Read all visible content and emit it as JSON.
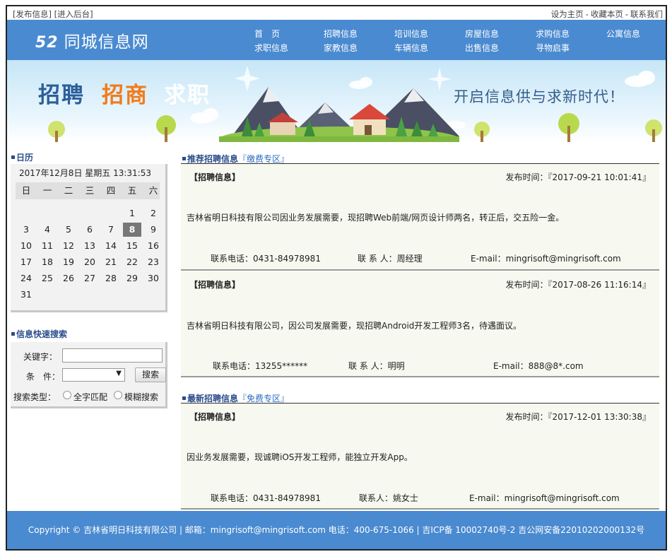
{
  "topbar": {
    "publish": "[发布信息]",
    "admin": "[进入后台]",
    "set_home": "设为主页",
    "bookmark": "收藏本页",
    "contact": "联系我们",
    "sep": "-"
  },
  "logo": {
    "num": "52",
    "text": "同城信息网"
  },
  "nav": {
    "home": "首　页",
    "job_seek": "求职信息",
    "recruit": "招聘信息",
    "tutor": "家教信息",
    "training": "培训信息",
    "vehicle": "车辆信息",
    "housing": "房屋信息",
    "sale": "出售信息",
    "purchase": "求购信息",
    "lost_found": "寻物启事",
    "apartment": "公寓信息"
  },
  "banner": {
    "word1": "招聘",
    "word2": "招商",
    "word3": "求职",
    "slogan": "开启信息供与求新时代！",
    "colors": {
      "word1": "#2c5f9a",
      "word2": "#f07b1c",
      "word3": "#ffffff"
    }
  },
  "calendar": {
    "title": "日历",
    "datetime": "2017年12月8日 星期五 13:31:53",
    "weekdays": [
      "日",
      "一",
      "二",
      "三",
      "四",
      "五",
      "六"
    ],
    "today": "8",
    "weeks": [
      [
        "",
        "",
        "",
        "",
        "",
        "1",
        "2"
      ],
      [
        "3",
        "4",
        "5",
        "6",
        "7",
        "8",
        "9"
      ],
      [
        "10",
        "11",
        "12",
        "13",
        "14",
        "15",
        "16"
      ],
      [
        "17",
        "18",
        "19",
        "20",
        "21",
        "22",
        "23"
      ],
      [
        "24",
        "25",
        "26",
        "27",
        "28",
        "29",
        "30"
      ],
      [
        "31",
        "",
        "",
        "",
        "",
        "",
        ""
      ]
    ]
  },
  "search": {
    "title": "信息快速搜索",
    "keyword_label": "关键字：",
    "keyword_value": "",
    "condition_label": "条　件：",
    "condition_value": "",
    "button": "搜索",
    "type_label": "搜索类型：",
    "exact": "全字匹配",
    "fuzzy": "模糊搜索"
  },
  "recommended": {
    "title": "推荐招聘信息",
    "tag": "『缴费专区』",
    "items": [
      {
        "type": "【招聘信息】",
        "time": "发布时间：『2017-09-21 10:01:41』",
        "desc": "吉林省明日科技有限公司因业务发展需要，现招聘Web前端/网页设计师两名，转正后，交五险一金。",
        "phone": "联系电话：0431-84978981",
        "person": "联 系 人：周经理",
        "email": "E-mail：mingrisoft@mingrisoft.com"
      },
      {
        "type": "【招聘信息】",
        "time": "发布时间：『2017-08-26 11:16:14』",
        "desc": "吉林省明日科技有限公司，因公司发展需要，现招聘Android开发工程师3名，待遇面议。",
        "phone": "联系电话：13255******",
        "person": "联 系 人：明明",
        "email": "E-mail：888@8*.com"
      }
    ]
  },
  "latest": {
    "title": "最新招聘信息",
    "tag": "『免费专区』",
    "items": [
      {
        "type": "【招聘信息】",
        "time": "发布时间：『2017-12-01 13:30:38』",
        "desc": "因业务发展需要，现诚聘iOS开发工程师，能独立开发App。",
        "phone": "联系电话：0431-84978981",
        "person": "联系人：姚女士",
        "email": "E-mail：mingrisoft@mingrisoft.com"
      }
    ]
  },
  "footer": {
    "text": "Copyright © 吉林省明日科技有限公司 | 邮箱：mingrisoft@mingrisoft.com  电话：400-675-1066 | 吉ICP备 10002740号-2 吉公网安备22010202000132号"
  }
}
